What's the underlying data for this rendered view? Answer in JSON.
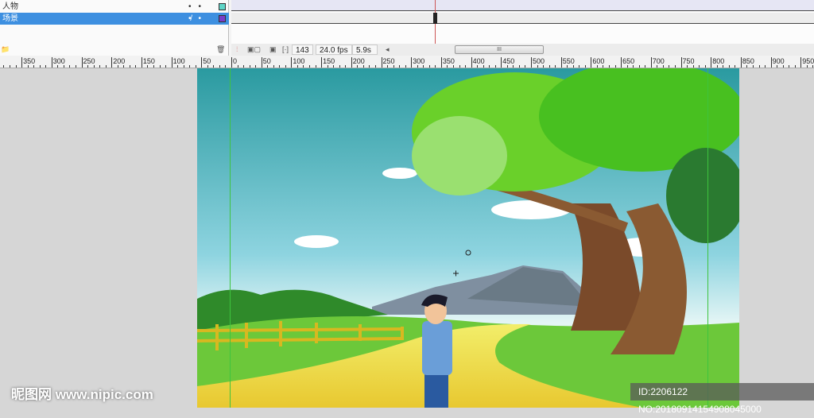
{
  "layers": [
    {
      "name": "人物",
      "color": "#5fd6c8",
      "selected": false
    },
    {
      "name": "场景",
      "color": "#7a3cc8",
      "selected": true
    }
  ],
  "timeline": {
    "current_frame": "143",
    "fps": "24.0 fps",
    "elapsed": "5.9s",
    "scroll_grip": "III"
  },
  "ruler": {
    "left_labels": [
      "350",
      "300",
      "250",
      "200",
      "150",
      "100",
      "50"
    ],
    "right_labels": [
      "0",
      "50",
      "100",
      "150",
      "200",
      "250",
      "300",
      "350",
      "400",
      "450",
      "500",
      "550",
      "600",
      "650",
      "700",
      "750",
      "800",
      "850",
      "900",
      "950"
    ]
  },
  "watermark": {
    "site": "昵图网 www.nipic.com",
    "id": "ID:2206122 NO:20180914154908045000"
  },
  "colors": {
    "selection": "#3d8fe0",
    "guide": "#3ec43e",
    "playhead": "#cc5555"
  }
}
